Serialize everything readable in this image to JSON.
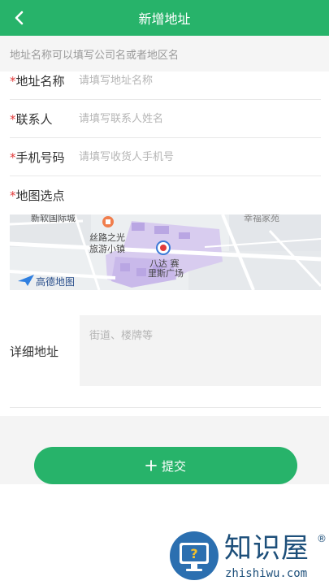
{
  "colors": {
    "primary": "#27b36a",
    "required": "#e23b3b"
  },
  "header": {
    "title": "新增地址",
    "back_icon": "chevron-left-icon"
  },
  "hint": "地址名称可以填写公司名或者地区名",
  "form": {
    "required_mark": "*",
    "name": {
      "label": "地址名称",
      "placeholder": "请填写地址名称"
    },
    "contact": {
      "label": "联系人",
      "placeholder": "请填写联系人姓名"
    },
    "phone": {
      "label": "手机号码",
      "placeholder": "请填写收货人手机号"
    },
    "map_pick": {
      "label": "地图选点"
    },
    "detail": {
      "label": "详细地址",
      "placeholder": "街道、楼牌等"
    }
  },
  "map": {
    "poi_1_line1": "丝路之光",
    "poi_1_line2": "旅游小镇",
    "poi_2_line1": "八达 赛",
    "poi_2_line2": "里斯广场",
    "top_left_text": "新软国际城",
    "top_right_text": "幸福家苑",
    "logo_text": "高德地图"
  },
  "submit": {
    "icon": "plus-icon",
    "label": "提交"
  },
  "watermark": {
    "title": "知识屋",
    "reg_mark": "®",
    "url": "zhishiwu.com"
  }
}
